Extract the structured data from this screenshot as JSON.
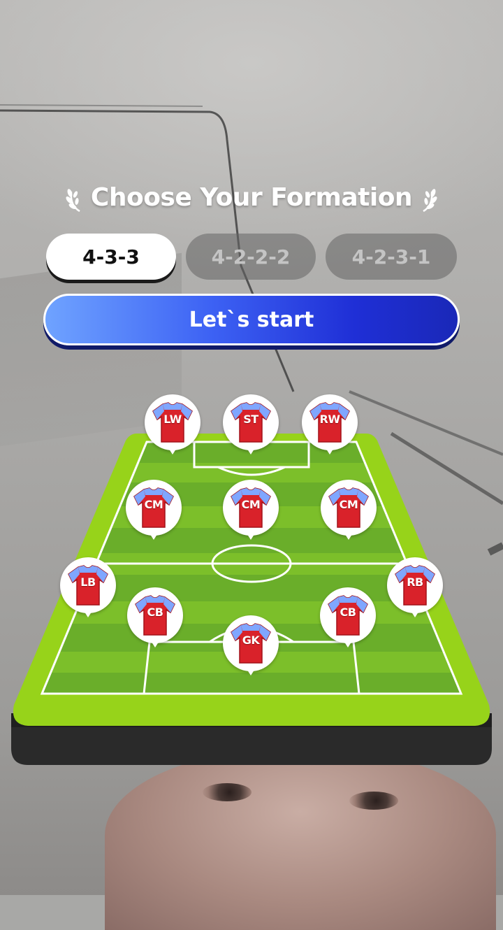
{
  "title": "Choose Your Formation",
  "formations": [
    {
      "label": "4-3-3",
      "selected": true
    },
    {
      "label": "4-2-2-2",
      "selected": false
    },
    {
      "label": "4-2-3-1",
      "selected": false
    }
  ],
  "start_button": "Let`s start",
  "players": [
    "LW",
    "ST",
    "RW",
    "CM",
    "CM",
    "CM",
    "LB",
    "CB",
    "GK",
    "CB",
    "RB"
  ],
  "colors": {
    "accent_blue": "#2f45e6",
    "pitch_green": "#8fcf1f",
    "jersey_red": "#d9222a",
    "jersey_sleeve": "#7fa6ff"
  }
}
